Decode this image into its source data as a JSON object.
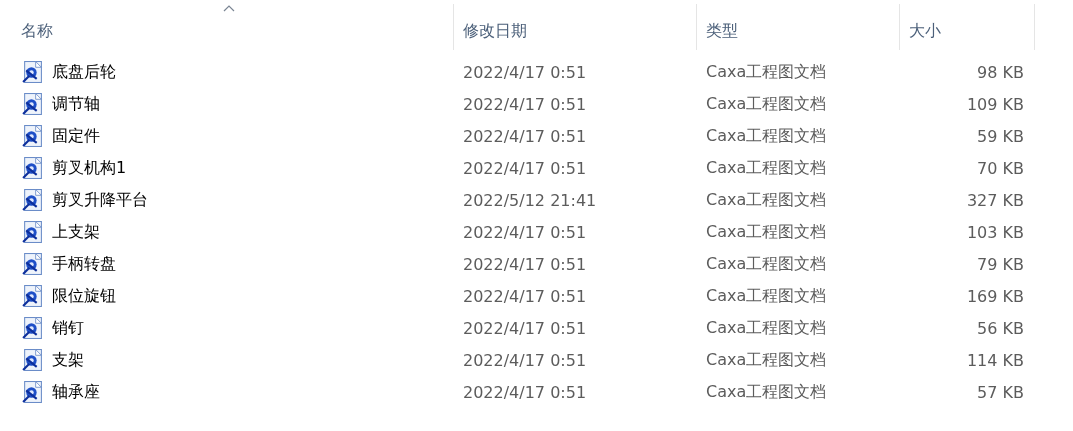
{
  "columns": [
    {
      "label": "名称",
      "sorted": true
    },
    {
      "label": "修改日期",
      "sorted": false
    },
    {
      "label": "类型",
      "sorted": false
    },
    {
      "label": "大小",
      "sorted": false
    }
  ],
  "files": [
    {
      "name": "底盘后轮",
      "modified": "2022/4/17 0:51",
      "type": "Caxa工程图文档",
      "size": "98 KB"
    },
    {
      "name": "调节轴",
      "modified": "2022/4/17 0:51",
      "type": "Caxa工程图文档",
      "size": "109 KB"
    },
    {
      "name": "固定件",
      "modified": "2022/4/17 0:51",
      "type": "Caxa工程图文档",
      "size": "59 KB"
    },
    {
      "name": "剪叉机构1",
      "modified": "2022/4/17 0:51",
      "type": "Caxa工程图文档",
      "size": "70 KB"
    },
    {
      "name": "剪叉升降平台",
      "modified": "2022/5/12 21:41",
      "type": "Caxa工程图文档",
      "size": "327 KB"
    },
    {
      "name": "上支架",
      "modified": "2022/4/17 0:51",
      "type": "Caxa工程图文档",
      "size": "103 KB"
    },
    {
      "name": "手柄转盘",
      "modified": "2022/4/17 0:51",
      "type": "Caxa工程图文档",
      "size": "79 KB"
    },
    {
      "name": "限位旋钮",
      "modified": "2022/4/17 0:51",
      "type": "Caxa工程图文档",
      "size": "169 KB"
    },
    {
      "name": "销钉",
      "modified": "2022/4/17 0:51",
      "type": "Caxa工程图文档",
      "size": "56 KB"
    },
    {
      "name": "支架",
      "modified": "2022/4/17 0:51",
      "type": "Caxa工程图文档",
      "size": "114 KB"
    },
    {
      "name": "轴承座",
      "modified": "2022/4/17 0:51",
      "type": "Caxa工程图文档",
      "size": "57 KB"
    }
  ]
}
